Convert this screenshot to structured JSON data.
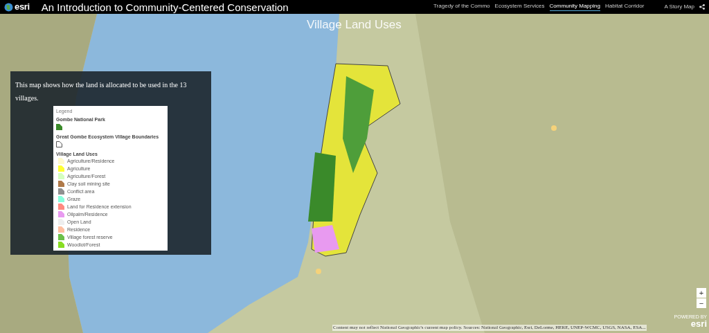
{
  "header": {
    "logo": "esri",
    "title": "An Introduction to Community-Centered Conservation",
    "nav": [
      {
        "label": "Tragedy of the Commo",
        "selected": false
      },
      {
        "label": "Ecosystem Services",
        "selected": false
      },
      {
        "label": "Community Mapping",
        "selected": true
      },
      {
        "label": "Habitat Corridor",
        "selected": false
      }
    ],
    "story_map": "A Story Map"
  },
  "map": {
    "title": "Village Land Uses",
    "zoom": [
      "+",
      "−"
    ],
    "attribution": "Content may not reflect National Geographic's current map policy. Sources: National Geographic, Esri, DeLorme, HERE, UNEP-WCMC, USGS, NASA, ESA...",
    "powered_by": "POWERED BY",
    "powered_logo": "esri"
  },
  "panel": {
    "text": "This map shows how the land is allocated to be used in the 13 villages.",
    "legend": {
      "title": "Legend",
      "sections": [
        {
          "title": "Gombe National Park",
          "items": [
            {
              "kind": "fill",
              "color": "#3a8a2a"
            }
          ]
        },
        {
          "title": "Great Gombe Ecosystem Village Boundaries",
          "items": [
            {
              "kind": "outline",
              "color": "#555555"
            }
          ]
        },
        {
          "title": "Village Land Uses",
          "items": [
            {
              "kind": "fill",
              "label": "Agriculture/Residence",
              "color": "#fffacd"
            },
            {
              "kind": "fill",
              "label": "Agriculture",
              "color": "#ffff33"
            },
            {
              "kind": "fill",
              "label": "Agriculture/Forest",
              "color": "#d4ffc0"
            },
            {
              "kind": "fill",
              "label": "Clay soil mining site",
              "color": "#b07a4a"
            },
            {
              "kind": "fill",
              "label": "Conflict area",
              "color": "#909090"
            },
            {
              "kind": "fill",
              "label": "Graze",
              "color": "#88ffdd"
            },
            {
              "kind": "fill",
              "label": "Land for Residence extension",
              "color": "#ff8a80"
            },
            {
              "kind": "fill",
              "label": "Oilpalm/Residence",
              "color": "#e89af0"
            },
            {
              "kind": "fill",
              "label": "Open Land",
              "color": "#eeeeee"
            },
            {
              "kind": "fill",
              "label": "Residence",
              "color": "#ffbfa0"
            },
            {
              "kind": "fill",
              "label": "Village forest reserve",
              "color": "#6cc04a"
            },
            {
              "kind": "fill",
              "label": "Woodlot/Forest",
              "color": "#88dd22"
            }
          ]
        }
      ]
    }
  }
}
